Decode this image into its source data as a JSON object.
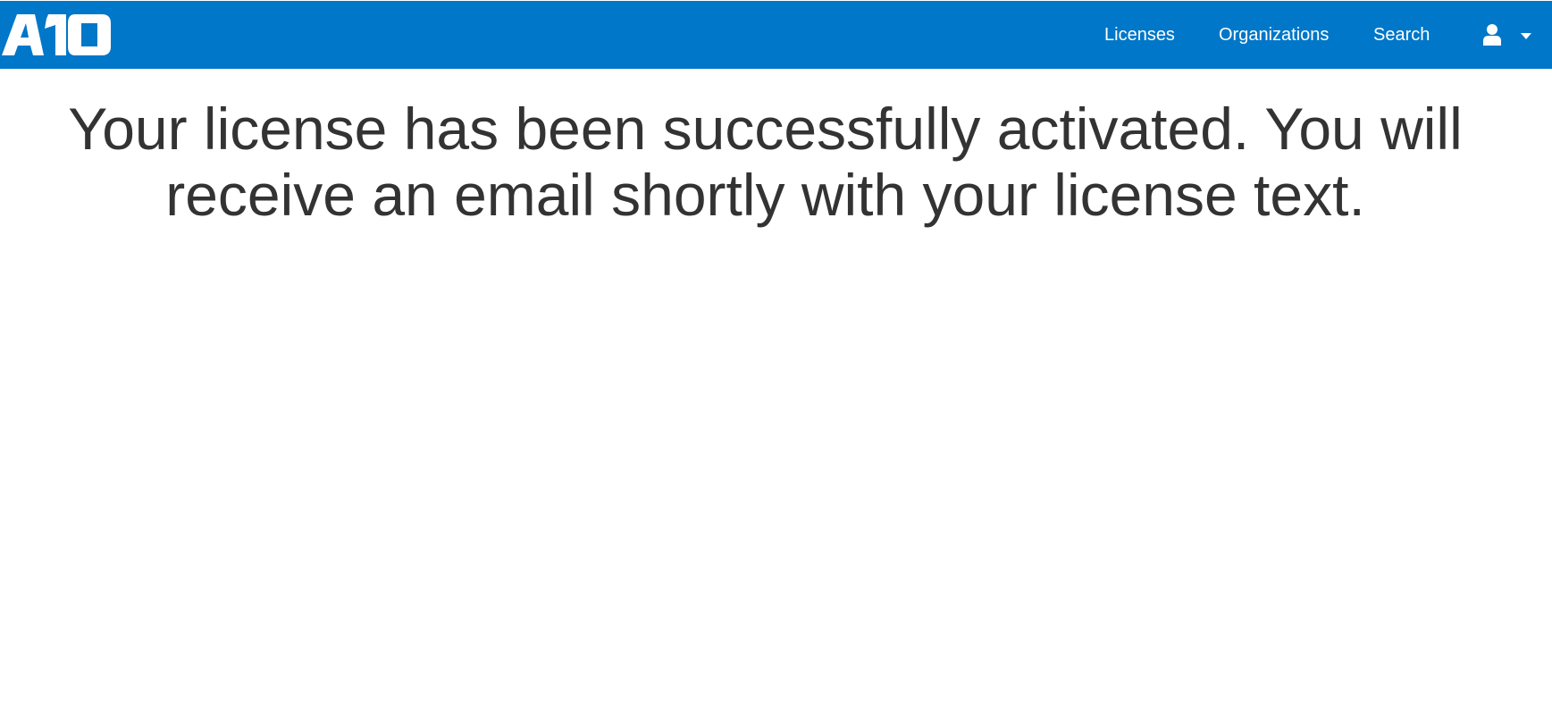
{
  "brand": {
    "logo_text": "A10"
  },
  "nav": {
    "items": [
      {
        "label": "Licenses"
      },
      {
        "label": "Organizations"
      },
      {
        "label": "Search"
      }
    ],
    "user_menu_icon": "user-icon",
    "user_menu_caret": "caret-down-icon"
  },
  "colors": {
    "navbar_bg": "#0077c8",
    "text": "#333333"
  },
  "main": {
    "message": "Your license has been successfully activated. You will receive an email shortly with your license text."
  }
}
